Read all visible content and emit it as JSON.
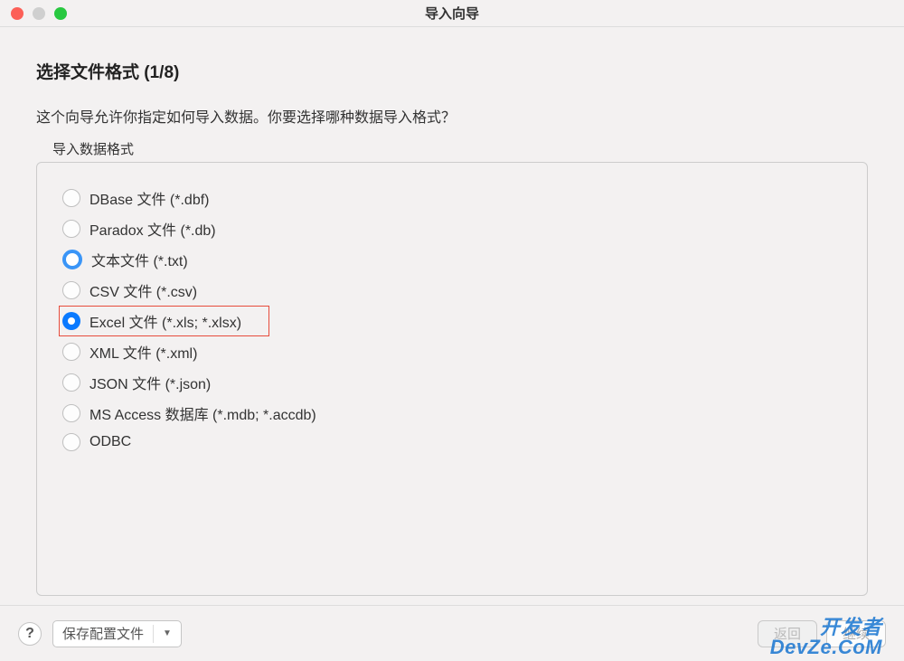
{
  "window": {
    "title": "导入向导"
  },
  "page": {
    "heading": "选择文件格式 (1/8)",
    "description": "这个向导允许你指定如何导入数据。你要选择哪种数据导入格式？",
    "group_label": "导入数据格式"
  },
  "options": [
    {
      "label": "DBase 文件 (*.dbf)",
      "state": "unchecked"
    },
    {
      "label": "Paradox 文件 (*.db)",
      "state": "unchecked"
    },
    {
      "label": "文本文件 (*.txt)",
      "state": "focused"
    },
    {
      "label": "CSV 文件 (*.csv)",
      "state": "unchecked"
    },
    {
      "label": "Excel 文件 (*.xls; *.xlsx)",
      "state": "selected",
      "highlighted": true
    },
    {
      "label": "XML 文件 (*.xml)",
      "state": "unchecked"
    },
    {
      "label": "JSON 文件 (*.json)",
      "state": "unchecked"
    },
    {
      "label": "MS Access 数据库 (*.mdb; *.accdb)",
      "state": "unchecked"
    },
    {
      "label": "ODBC",
      "state": "unchecked"
    }
  ],
  "footer": {
    "help": "?",
    "save_config": "保存配置文件",
    "back": "返回",
    "continue": "继续"
  },
  "watermark": {
    "line1": "开发者",
    "line2": "DevZe.CoM"
  }
}
